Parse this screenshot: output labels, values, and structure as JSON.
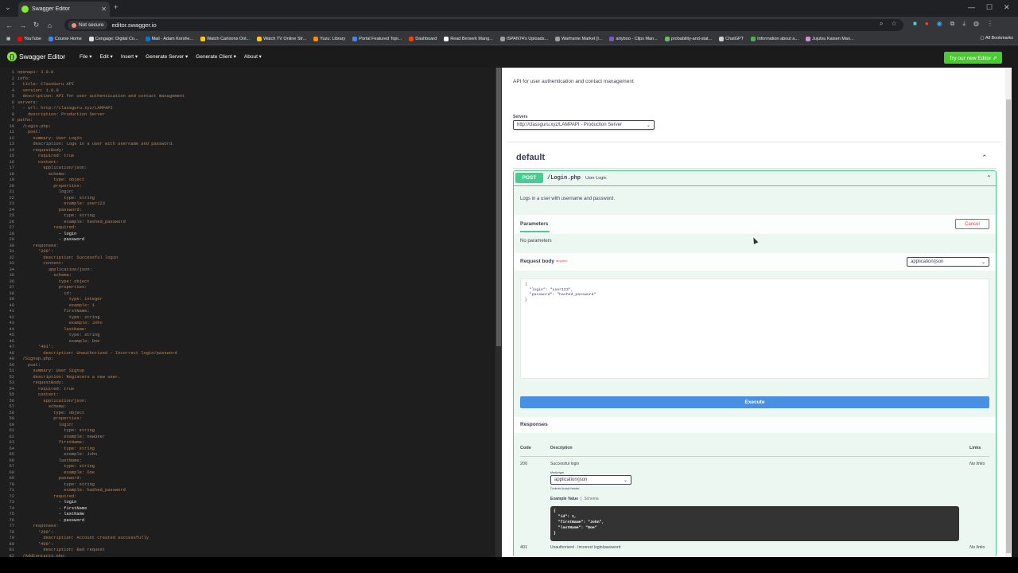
{
  "browser": {
    "tab_title": "Swagger Editor",
    "security_label": "Not secure",
    "url": "editor.swagger.io",
    "bookmarks": [
      "YouTube",
      "Course Home",
      "Cengage: Digital Co...",
      "Mail - Adam Korshe...",
      "Watch Cartoons Onl...",
      "Watch TV Online Str...",
      "Yuzu: Library",
      "Portal Featured Topi...",
      "Dashboard",
      "Read Berserk Mang...",
      "ISPAN74's Uploads...",
      "Warframe Market [I...",
      "artyboo - Clips Man...",
      "probability-and-stat...",
      "ChatGPT",
      "Information about a...",
      "Jujutsu Kaisen Man..."
    ],
    "all_bookmarks": "All Bookmarks",
    "colors": {
      "chrome_dark": "#202124",
      "chrome": "#35363a"
    }
  },
  "swagger": {
    "logo_name": "Swagger Editor",
    "menu": [
      "File ▾",
      "Edit ▾",
      "Insert ▾",
      "Generate Server ▾",
      "Generate Client ▾",
      "About ▾"
    ],
    "try_new": "Try our new Editor ⇗"
  },
  "editor": {
    "lines": [
      [
        "1",
        "openapi: 3.0.0"
      ],
      [
        "2",
        "info:"
      ],
      [
        "3",
        "  title: ClassGuru API"
      ],
      [
        "4",
        "  version: 1.0.0"
      ],
      [
        "5",
        "  description: API for user authentication and contact management"
      ],
      [
        "6",
        "servers:"
      ],
      [
        "7",
        "  - url: http://classguru.xyz/LAMPAPI"
      ],
      [
        "8",
        "    description: Production Server"
      ],
      [
        "9",
        "paths:"
      ],
      [
        "10",
        "  /Login.php:"
      ],
      [
        "11",
        "    post:"
      ],
      [
        "12",
        "      summary: User Login"
      ],
      [
        "13",
        "      description: Logs in a user with username and password."
      ],
      [
        "14",
        "      requestBody:"
      ],
      [
        "15",
        "        required: true"
      ],
      [
        "16",
        "        content:"
      ],
      [
        "17",
        "          application/json:"
      ],
      [
        "18",
        "            schema:"
      ],
      [
        "19",
        "              type: object"
      ],
      [
        "20",
        "              properties:"
      ],
      [
        "21",
        "                login:"
      ],
      [
        "22",
        "                  type: string"
      ],
      [
        "23",
        "                  example: user123"
      ],
      [
        "24",
        "                password:"
      ],
      [
        "25",
        "                  type: string"
      ],
      [
        "26",
        "                  example: hashed_password"
      ],
      [
        "27",
        "              required:"
      ],
      [
        "28",
        "                - login"
      ],
      [
        "29",
        "                - password"
      ],
      [
        "30",
        "      responses:"
      ],
      [
        "31",
        "        '200':"
      ],
      [
        "32",
        "          description: Successful login"
      ],
      [
        "33",
        "          content:"
      ],
      [
        "34",
        "            application/json:"
      ],
      [
        "35",
        "              schema:"
      ],
      [
        "36",
        "                type: object"
      ],
      [
        "37",
        "                properties:"
      ],
      [
        "38",
        "                  id:"
      ],
      [
        "39",
        "                    type: integer"
      ],
      [
        "40",
        "                    example: 1"
      ],
      [
        "41",
        "                  firstName:"
      ],
      [
        "42",
        "                    type: string"
      ],
      [
        "43",
        "                    example: John"
      ],
      [
        "44",
        "                  lastName:"
      ],
      [
        "45",
        "                    type: string"
      ],
      [
        "46",
        "                    example: Doe"
      ],
      [
        "47",
        "        '401':"
      ],
      [
        "48",
        "          description: Unauthorized - Incorrect login/password"
      ],
      [
        "49",
        "  /Signup.php:"
      ],
      [
        "50",
        "    post:"
      ],
      [
        "51",
        "      summary: User Signup"
      ],
      [
        "52",
        "      description: Registers a new user."
      ],
      [
        "53",
        "      requestBody:"
      ],
      [
        "54",
        "        required: true"
      ],
      [
        "55",
        "        content:"
      ],
      [
        "56",
        "          application/json:"
      ],
      [
        "57",
        "            schema:"
      ],
      [
        "58",
        "              type: object"
      ],
      [
        "59",
        "              properties:"
      ],
      [
        "60",
        "                login:"
      ],
      [
        "61",
        "                  type: string"
      ],
      [
        "62",
        "                  example: newUser"
      ],
      [
        "63",
        "                firstName:"
      ],
      [
        "64",
        "                  type: string"
      ],
      [
        "65",
        "                  example: John"
      ],
      [
        "66",
        "                lastName:"
      ],
      [
        "67",
        "                  type: string"
      ],
      [
        "68",
        "                  example: Doe"
      ],
      [
        "69",
        "                password:"
      ],
      [
        "70",
        "                  type: string"
      ],
      [
        "71",
        "                  example: hashed_password"
      ],
      [
        "72",
        "              required:"
      ],
      [
        "73",
        "                - login"
      ],
      [
        "74",
        "                - firstName"
      ],
      [
        "75",
        "                - lastName"
      ],
      [
        "76",
        "                - password"
      ],
      [
        "77",
        "      responses:"
      ],
      [
        "78",
        "        '200':"
      ],
      [
        "79",
        "          description: Account created successfully"
      ],
      [
        "80",
        "        '400':"
      ],
      [
        "81",
        "          description: Bad request"
      ],
      [
        "82",
        "  /AddContacts.php:"
      ]
    ]
  },
  "preview": {
    "api_description": "API for user authentication and contact management",
    "servers_label": "Servers",
    "server_selected": "http://classguru.xyz/LAMPAPI - Production Server",
    "section_title": "default",
    "operation": {
      "method": "POST",
      "path": "/Login.php",
      "summary": "User Login",
      "description": "Logs in a user with username and password.",
      "parameters_tab": "Parameters",
      "cancel": "Cancel",
      "no_parameters": "No parameters",
      "request_body_label": "Request body",
      "required_label": "required",
      "content_type": "application/json",
      "request_body_text": "{\n  \"login\": \"user123\",\n  \"password\": \"hashed_password\"\n}",
      "execute": "Execute",
      "responses_label": "Responses",
      "table_headers": {
        "code": "Code",
        "description": "Description",
        "links": "Links"
      },
      "responses": [
        {
          "code": "200",
          "description": "Successful login",
          "links": "No links"
        },
        {
          "code": "401",
          "description": "Unauthorized - Incorrect login/password",
          "links": "No links"
        }
      ],
      "media_type_label": "Media type",
      "media_type": "application/json",
      "controls_accept": "Controls Accept header.",
      "example_value_tab": "Example Value",
      "schema_tab": "Schema",
      "example_value_text": "{\n  \"id\": 1,\n  \"firstName\": \"John\",\n  \"lastName\": \"Doe\"\n}"
    },
    "colors": {
      "post": "#49cc90",
      "execute": "#4990e2",
      "cancel": "#f93e3e"
    }
  }
}
